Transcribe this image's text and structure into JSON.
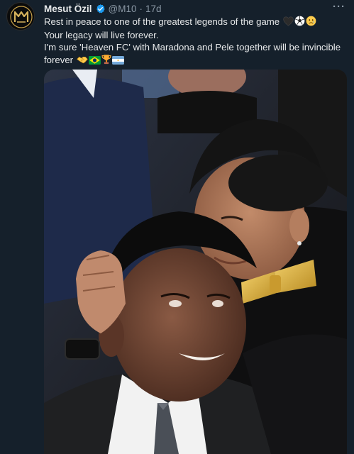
{
  "author": {
    "display_name": "Mesut Özil",
    "handle": "@M10",
    "separator": "·",
    "time": "17d",
    "avatar_icon": "m10-logo-icon",
    "verified_icon": "verified-badge-icon"
  },
  "tweet": {
    "line1": "Rest in peace to one of the greatest legends of the game",
    "line1_emojis": [
      "black-heart-icon",
      "soccer-ball-icon",
      "sad-face-icon"
    ],
    "line2": "Your legacy will live forever.",
    "line3": "I'm sure 'Heaven FC' with Maradona and Pele together will be invincible",
    "line4": "forever",
    "line4_emojis": [
      "handshake-icon",
      "brazil-flag-icon",
      "trophy-icon",
      "argentina-flag-icon"
    ]
  },
  "media": {
    "photo_icon": "tweet-photo",
    "colors": {
      "background": "#15202b",
      "text": "#e7e9ea",
      "secondary": "#8b98a5",
      "verified": "#1d9bf0",
      "bowtie": "#d8ad3c"
    }
  },
  "actions": {
    "more_icon": "more-options-icon",
    "more_label": "···"
  }
}
